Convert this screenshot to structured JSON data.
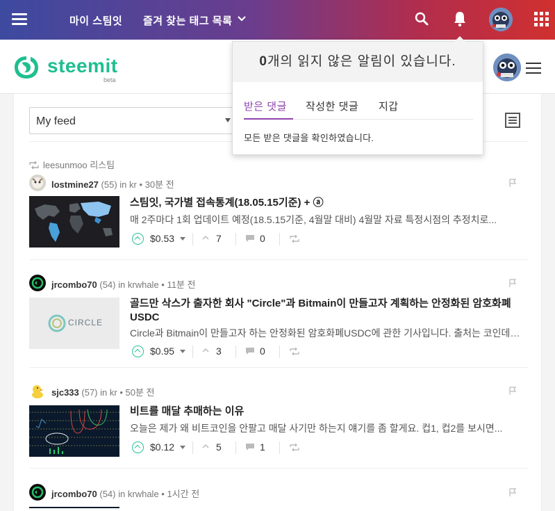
{
  "topbar": {
    "nav_my_steemit": "마이 스팀잇",
    "nav_fav_tags": "즐겨 찾는 태그 목록"
  },
  "header": {
    "logo_text": "steemit",
    "logo_badge": "beta"
  },
  "feed": {
    "selected": "My feed",
    "resteem_label": "leesunmoo 리스팀",
    "posts": [
      {
        "author": "lostmine27",
        "rep": "(55)",
        "in": "in",
        "tag": "kr",
        "time": "30분 전",
        "title": "스팀잇, 국가별 접속통계(18.05.15기준) + ⓐ",
        "body": "매 2주마다 1회 업데이트 예정(18.5.15기준, 4월말 대비) 4월말 자료 특정시점의 추정치로...",
        "payout": "$0.53",
        "votes": "7",
        "comments": "0"
      },
      {
        "author": "jrcombo70",
        "rep": "(54)",
        "in": "in",
        "tag": "krwhale",
        "time": "11분 전",
        "title": "골드만 삭스가 출자한 회사 \"Circle\"과 Bitmain이 만들고자 계획하는 안정화된 암호화폐 USDC",
        "body": "Circle과 Bitmain이 만들고자 하는 안정화된 암호화폐USDC에 관한 기사입니다. 출처는 코인데스크...",
        "payout": "$0.95",
        "votes": "3",
        "comments": "0",
        "thumb_text": "CIRCLE"
      },
      {
        "author": "sjc333",
        "rep": "(57)",
        "in": "in",
        "tag": "kr",
        "time": "50분 전",
        "title": "비트를 매달 추매하는 이유",
        "body": "오늘은 제가 왜 비트코인을 안팔고 매달 사기만 하는지 얘기를 좀 할게요. 컵1, 컵2를 보시면...",
        "payout": "$0.12",
        "votes": "5",
        "comments": "1"
      },
      {
        "author": "jrcombo70",
        "rep": "(54)",
        "in": "in",
        "tag": "krwhale",
        "time": "1시간 전"
      }
    ]
  },
  "notifications": {
    "count": "0",
    "header_rest": "개의 읽지 않은 알림이 있습니다.",
    "tabs": [
      "받은 댓글",
      "작성한 댓글",
      "지갑"
    ],
    "message": "모든 받은 댓글을 확인하였습니다."
  },
  "colors": {
    "accent_green": "#1fbf8f",
    "tab_active": "#8e44ad"
  }
}
